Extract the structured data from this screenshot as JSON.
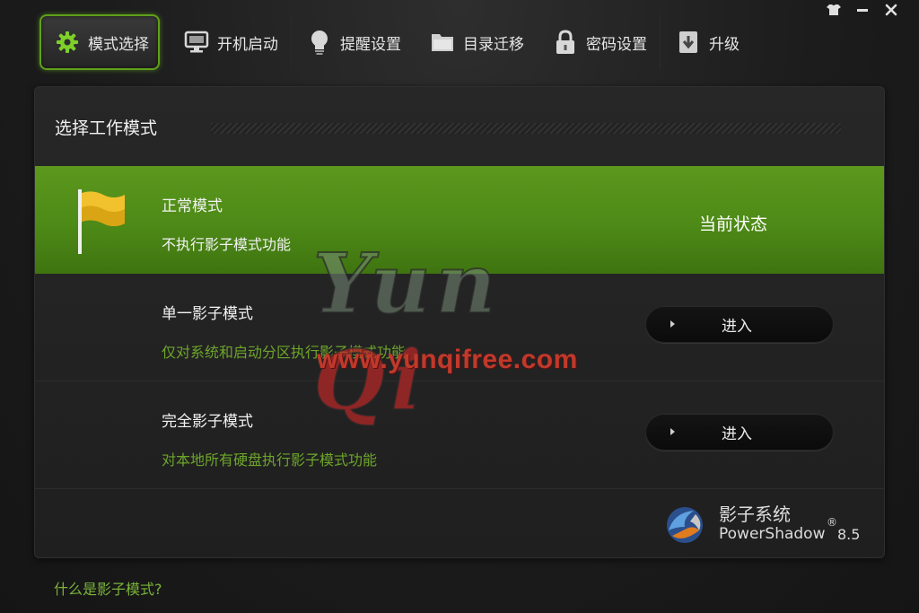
{
  "window": {
    "controls": [
      "skin-icon",
      "minimize-icon",
      "close-icon"
    ]
  },
  "nav": {
    "tabs": [
      {
        "label": "模式选择",
        "icon": "gear-icon",
        "active": true
      },
      {
        "label": "开机启动",
        "icon": "monitor-icon",
        "active": false
      },
      {
        "label": "提醒设置",
        "icon": "bulb-icon",
        "active": false
      },
      {
        "label": "目录迁移",
        "icon": "folder-icon",
        "active": false
      },
      {
        "label": "密码设置",
        "icon": "lock-icon",
        "active": false
      },
      {
        "label": "升级",
        "icon": "upgrade-icon",
        "active": false
      }
    ]
  },
  "panel": {
    "title": "选择工作模式",
    "modes": [
      {
        "name": "正常模式",
        "desc": "不执行影子模式功能",
        "status": "当前状态",
        "active": true,
        "icon": "flag-icon"
      },
      {
        "name": "单一影子模式",
        "desc": "仅对系统和启动分区执行影子模式功能",
        "button": "进入",
        "active": false
      },
      {
        "name": "完全影子模式",
        "desc": "对本地所有硬盘执行影子模式功能",
        "button": "进入",
        "active": false
      }
    ]
  },
  "brand": {
    "name_cn": "影子系统",
    "name_en": "PowerShadow",
    "reg": "®",
    "version": "8.5"
  },
  "footer": {
    "help_link": "什么是影子模式?"
  },
  "watermark": {
    "script_a": "Yun",
    "script_b": "Qi",
    "url": "www.yunqifree.com"
  },
  "colors": {
    "accent": "#5fa01a",
    "active_row": "#4d8a17",
    "desc_green": "#6da52a",
    "link_green": "#7ab33a",
    "watermark_red": "#c0392b"
  }
}
